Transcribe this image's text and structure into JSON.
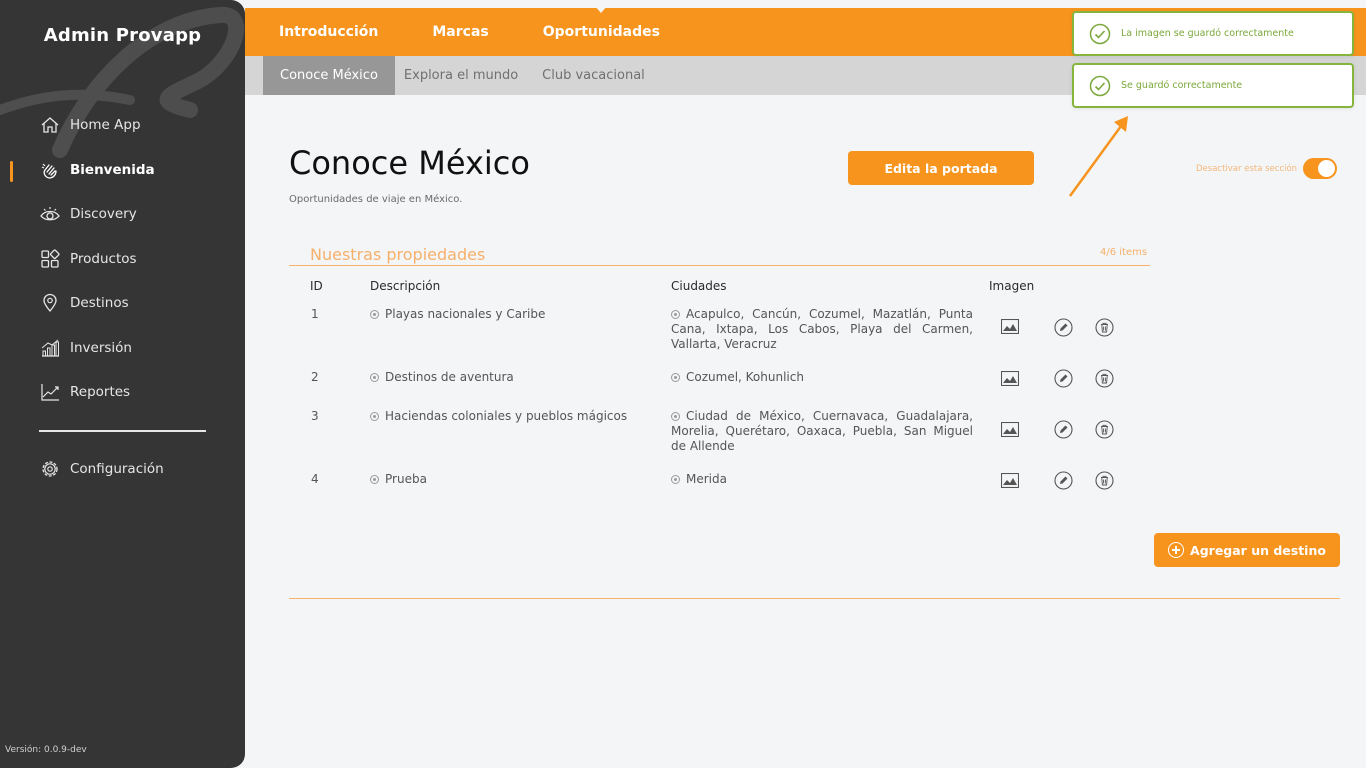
{
  "sidebar": {
    "brand": "Admin Provapp",
    "items": [
      {
        "label": "Home App",
        "icon": "home-icon"
      },
      {
        "label": "Bienvenida",
        "icon": "waving-hand-icon",
        "active": true
      },
      {
        "label": "Discovery",
        "icon": "eye-icon"
      },
      {
        "label": "Productos",
        "icon": "grid-icon"
      },
      {
        "label": "Destinos",
        "icon": "map-pin-icon"
      },
      {
        "label": "Inversión",
        "icon": "bar-chart-icon"
      },
      {
        "label": "Reportes",
        "icon": "line-chart-icon"
      }
    ],
    "config_label": "Configuración",
    "version": "Versión: 0.0.9-dev"
  },
  "topnav": {
    "tabs": [
      "Introducción",
      "Marcas",
      "Oportunidades"
    ],
    "current": "Oportunidades"
  },
  "subnav": {
    "tabs": [
      "Conoce México",
      "Explora el mundo",
      "Club vacacional"
    ],
    "active": "Conoce México"
  },
  "page": {
    "title": "Conoce México",
    "subtitle": "Oportunidades de viaje en México.",
    "edit_button": "Edita la portada",
    "toggle_label": "Desactivar esta sección",
    "toggle_on": true
  },
  "section": {
    "title": "Nuestras propiedades",
    "count": "4/6 items"
  },
  "table": {
    "headers": {
      "id": "ID",
      "desc": "Descripción",
      "cities": "Ciudades",
      "image": "Imagen"
    },
    "rows": [
      {
        "id": "1",
        "desc": "Playas nacionales y Caribe",
        "cities": "Acapulco, Cancún, Cozumel, Mazatlán, Punta Cana, Ixtapa, Los Cabos, Playa del Carmen, Vallarta, Veracruz"
      },
      {
        "id": "2",
        "desc": "Destinos de aventura",
        "cities": "Cozumel, Kohunlich"
      },
      {
        "id": "3",
        "desc": "Haciendas coloniales y pueblos mágicos",
        "cities": "Ciudad de México, Cuernavaca, Guadalajara, Morelia, Querétaro, Oaxaca, Puebla, San Miguel de Allende"
      },
      {
        "id": "4",
        "desc": "Prueba",
        "cities": "Merida"
      }
    ]
  },
  "add_button": "Agregar un destino",
  "toasts": [
    "La imagen se guardó correctamente",
    "Se guardó correctamente"
  ],
  "colors": {
    "accent": "#f7941d",
    "sidebar": "#353535",
    "success": "#86b53d"
  }
}
